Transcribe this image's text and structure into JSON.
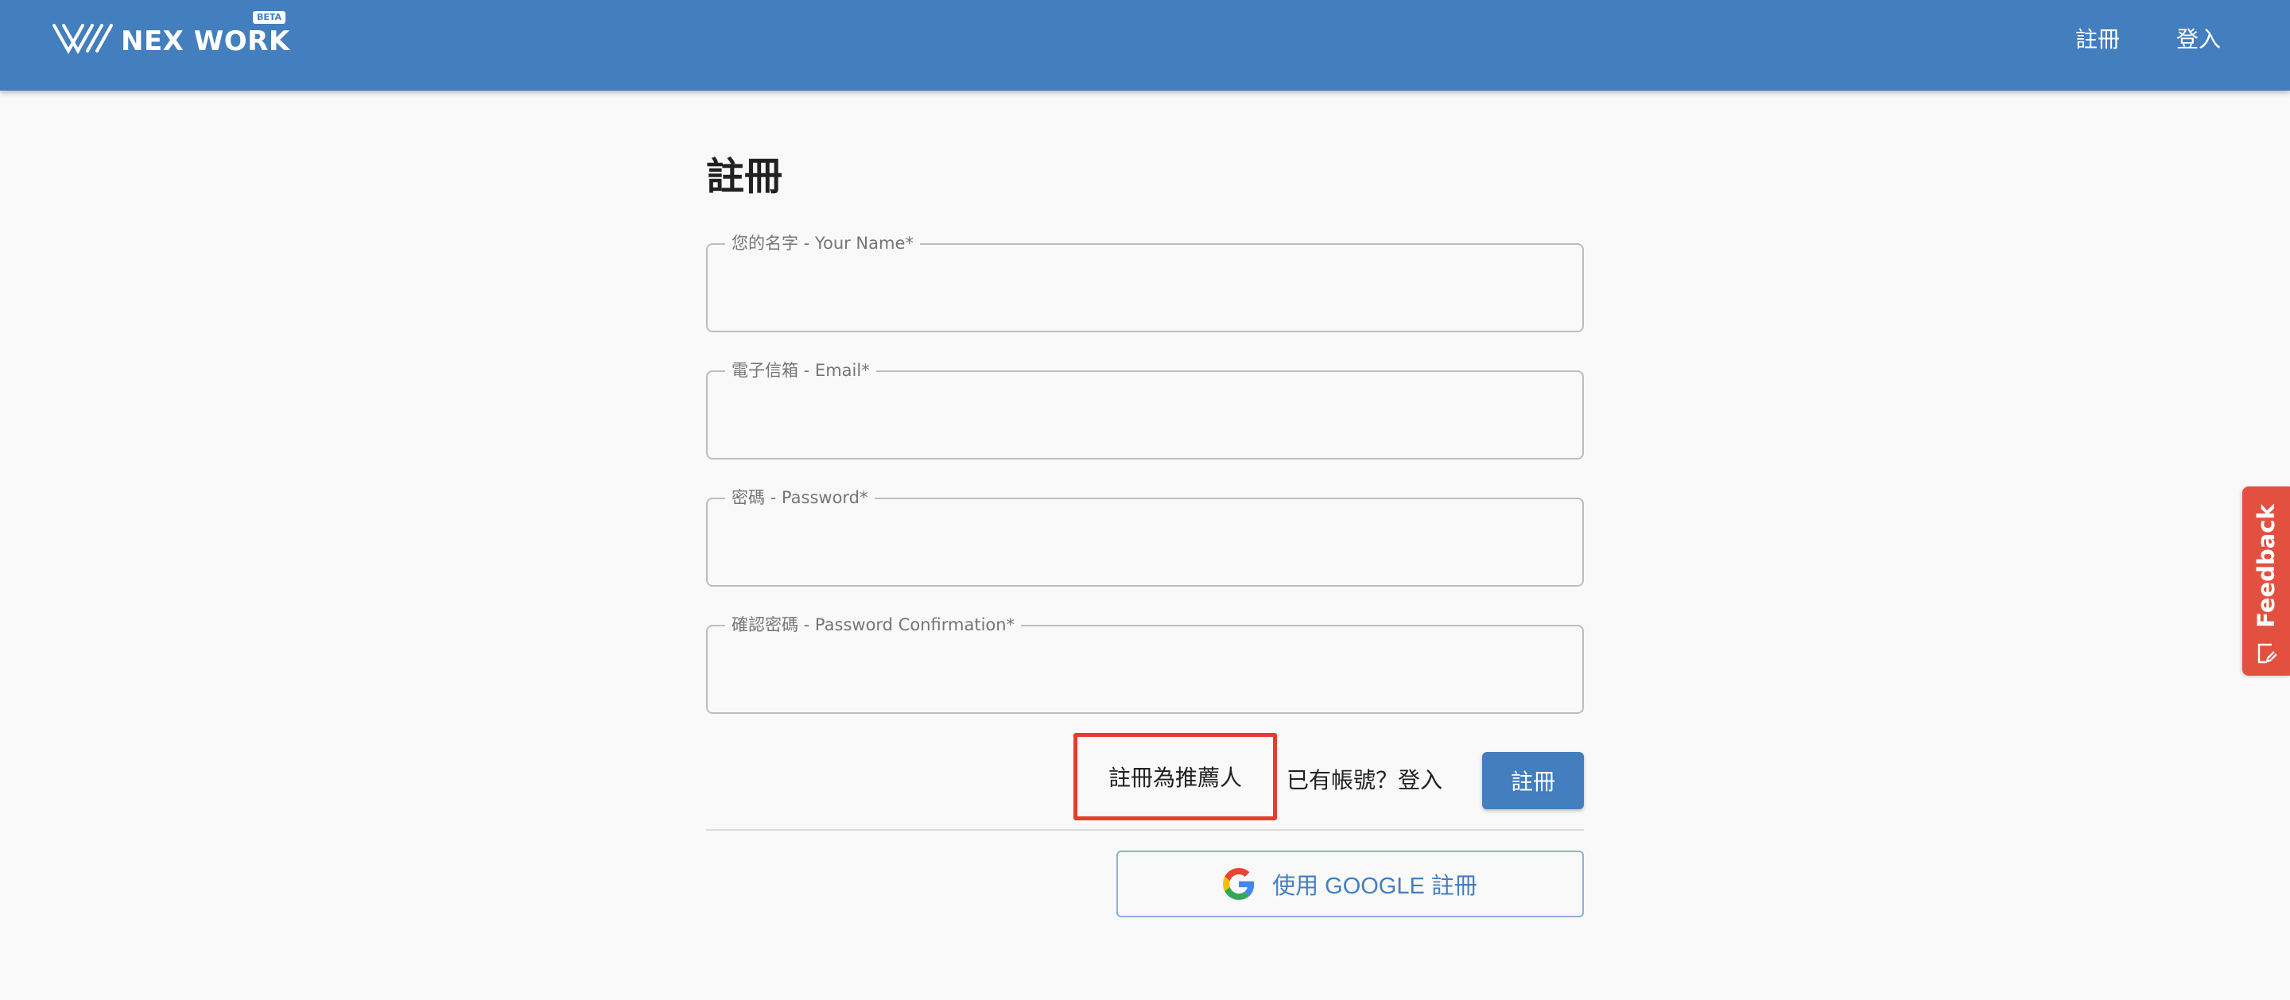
{
  "header": {
    "logo_text": "NEX WORK",
    "beta_badge": "BETA",
    "nav": {
      "register": "註冊",
      "login": "登入"
    }
  },
  "form": {
    "title": "註冊",
    "fields": {
      "name": {
        "label": "您的名字 - Your Name*",
        "value": ""
      },
      "email": {
        "label": "電子信箱 - Email*",
        "value": ""
      },
      "password": {
        "label": "密碼 - Password*",
        "value": ""
      },
      "password_confirmation": {
        "label": "確認密碼 - Password Confirmation*",
        "value": ""
      }
    },
    "referrer_link": "註冊為推薦人",
    "have_account_link": "已有帳號？登入",
    "submit": "註冊",
    "google_button": "使用 GOOGLE 註冊"
  },
  "feedback_tab": {
    "label": "Feedback"
  },
  "colors": {
    "primary": "#437ebf",
    "highlight": "#e53d2a",
    "feedback": "#e4503f",
    "background": "#f9f9f9"
  },
  "icons": {
    "logo": "nexwork-logo-icon",
    "google": "google-g-icon",
    "feedback": "feedback-edit-icon"
  }
}
